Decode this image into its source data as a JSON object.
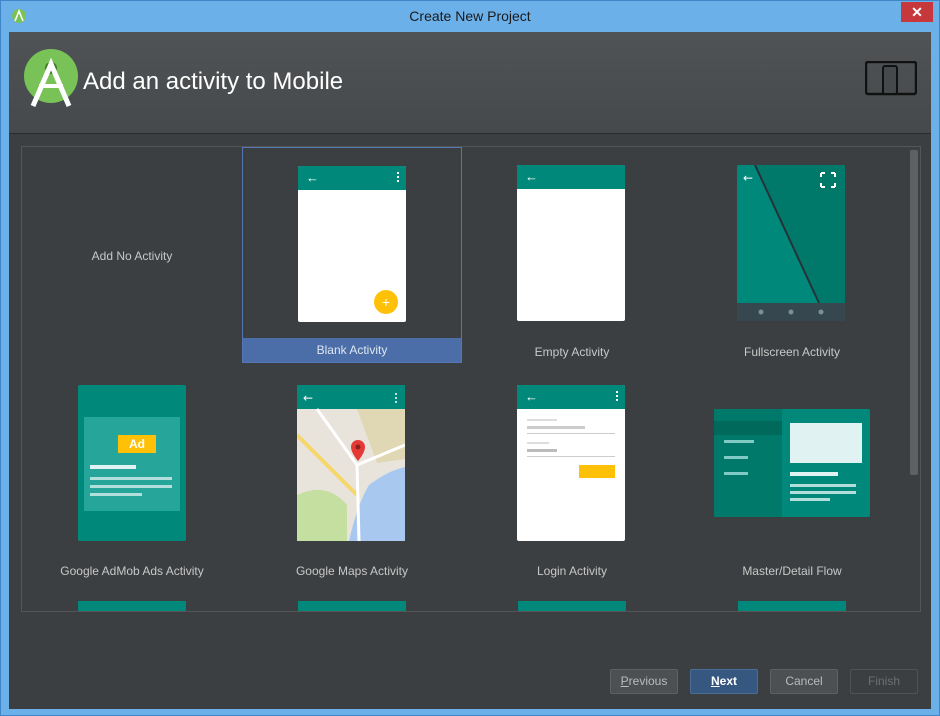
{
  "window": {
    "title": "Create New Project",
    "close": "✕"
  },
  "header": {
    "title": "Add an activity to Mobile"
  },
  "activities": [
    {
      "label": "Add No Activity"
    },
    {
      "label": "Blank Activity"
    },
    {
      "label": "Empty Activity"
    },
    {
      "label": "Fullscreen Activity"
    },
    {
      "label": "Google AdMob Ads Activity",
      "badge": "Ad"
    },
    {
      "label": "Google Maps Activity"
    },
    {
      "label": "Login Activity"
    },
    {
      "label": "Master/Detail Flow"
    }
  ],
  "selected_index": 1,
  "buttons": {
    "previous": {
      "first": "P",
      "rest": "revious"
    },
    "next": {
      "first": "N",
      "rest": "ext"
    },
    "cancel": "Cancel",
    "finish": "Finish"
  },
  "colors": {
    "accent": "#00897b",
    "fab": "#ffc107",
    "selection": "#4c6ea8"
  }
}
